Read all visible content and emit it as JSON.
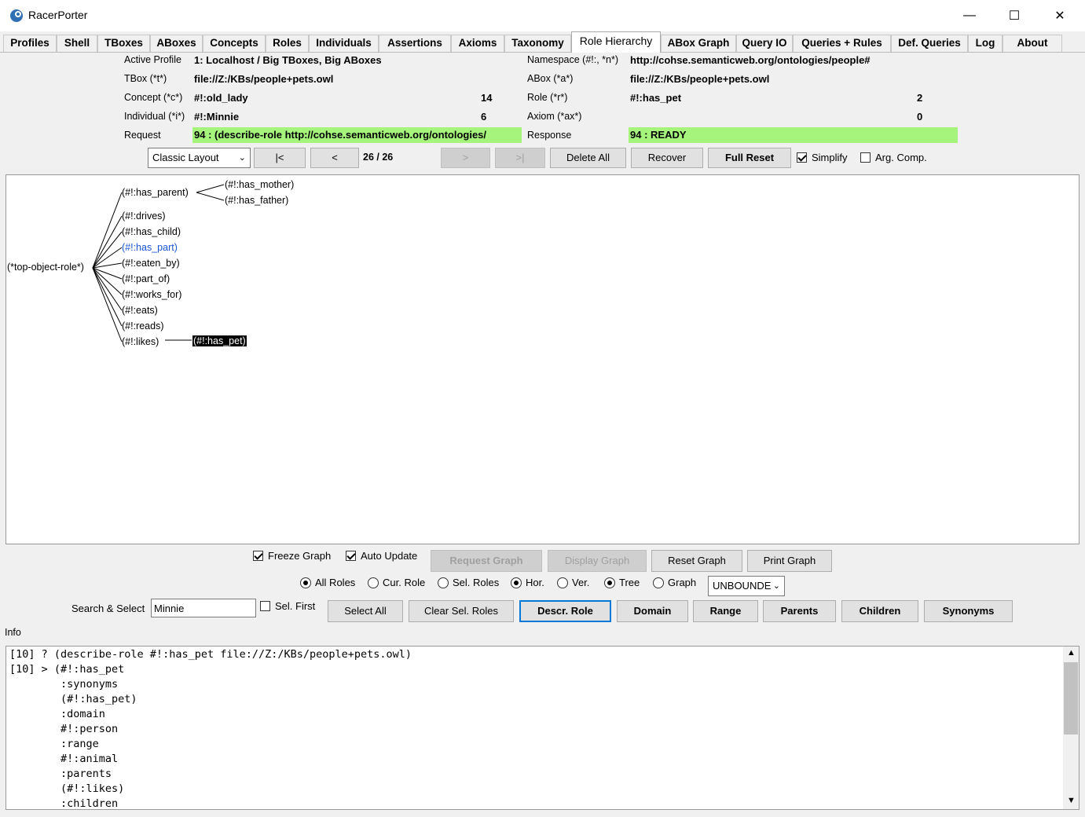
{
  "window": {
    "title": "RacerPorter",
    "minimize": "—",
    "maximize": "☐",
    "close": "✕"
  },
  "tabs": [
    "Profiles",
    "Shell",
    "TBoxes",
    "ABoxes",
    "Concepts",
    "Roles",
    "Individuals",
    "Assertions",
    "Axioms",
    "Taxonomy",
    "Role Hierarchy",
    "ABox Graph",
    "Query IO",
    "Queries + Rules",
    "Def. Queries",
    "Log",
    "About"
  ],
  "active_tab": "Role Hierarchy",
  "status": {
    "active_profile_label": "Active Profile",
    "active_profile": "1: Localhost / Big TBoxes, Big ABoxes",
    "namespace_label": "Namespace (#!:, *n*)",
    "namespace": "http://cohse.semanticweb.org/ontologies/people#",
    "tbox_label": "TBox (*t*)",
    "tbox": "file://Z:/KBs/people+pets.owl",
    "abox_label": "ABox (*a*)",
    "abox": "file://Z:/KBs/people+pets.owl",
    "concept_label": "Concept (*c*)",
    "concept": "#!:old_lady",
    "concept_count": "14",
    "role_label": "Role (*r*)",
    "role": "#!:has_pet",
    "role_count": "2",
    "individual_label": "Individual (*i*)",
    "individual": "#!:Minnie",
    "individual_count": "6",
    "axiom_label": "Axiom (*ax*)",
    "axiom_count": "0",
    "request_label": "Request",
    "request": "94 : (describe-role http://cohse.semanticweb.org/ontologies/",
    "response_label": "Response",
    "response": "94 : READY"
  },
  "toolbar": {
    "layout": "Classic Layout",
    "first": "|<",
    "prev": "<",
    "counter": "26 / 26",
    "next": ">",
    "last": ">|",
    "delete_all": "Delete All",
    "recover": "Recover",
    "full_reset": "Full Reset",
    "simplify": "Simplify",
    "arg_comp": "Arg. Comp."
  },
  "graph": {
    "root": "(*top-object-role*)",
    "children": [
      "(#!:has_parent)",
      "(#!:drives)",
      "(#!:has_child)",
      "(#!:has_part)",
      "(#!:eaten_by)",
      "(#!:part_of)",
      "(#!:works_for)",
      "(#!:eats)",
      "(#!:reads)",
      "(#!:likes)"
    ],
    "has_parent_children": [
      "(#!:has_mother)",
      "(#!:has_father)"
    ],
    "likes_child": "(#!:has_pet)"
  },
  "controls": {
    "freeze_graph": "Freeze Graph",
    "auto_update": "Auto Update",
    "request_graph": "Request Graph",
    "display_graph": "Display Graph",
    "reset_graph": "Reset Graph",
    "print_graph": "Print Graph",
    "all_roles": "All Roles",
    "cur_role": "Cur. Role",
    "sel_roles": "Sel. Roles",
    "hor": "Hor.",
    "ver": "Ver.",
    "tree": "Tree",
    "graph_opt": "Graph",
    "depth": "UNBOUNDE",
    "search_label": "Search & Select",
    "search_value": "Minnie",
    "sel_first": "Sel. First",
    "select_all": "Select All",
    "clear_sel_roles": "Clear Sel. Roles",
    "descr_role": "Descr. Role",
    "domain": "Domain",
    "range": "Range",
    "parents": "Parents",
    "children": "Children",
    "synonyms": "Synonyms",
    "info_label": "Info"
  },
  "log": [
    "[10] ? (describe-role #!:has_pet file://Z:/KBs/people+pets.owl)",
    "[10] > (#!:has_pet",
    "        :synonyms",
    "        (#!:has_pet)",
    "        :domain",
    "        #!:person",
    "        :range",
    "        #!:animal",
    "        :parents",
    "        (#!:likes)",
    "        :children"
  ]
}
